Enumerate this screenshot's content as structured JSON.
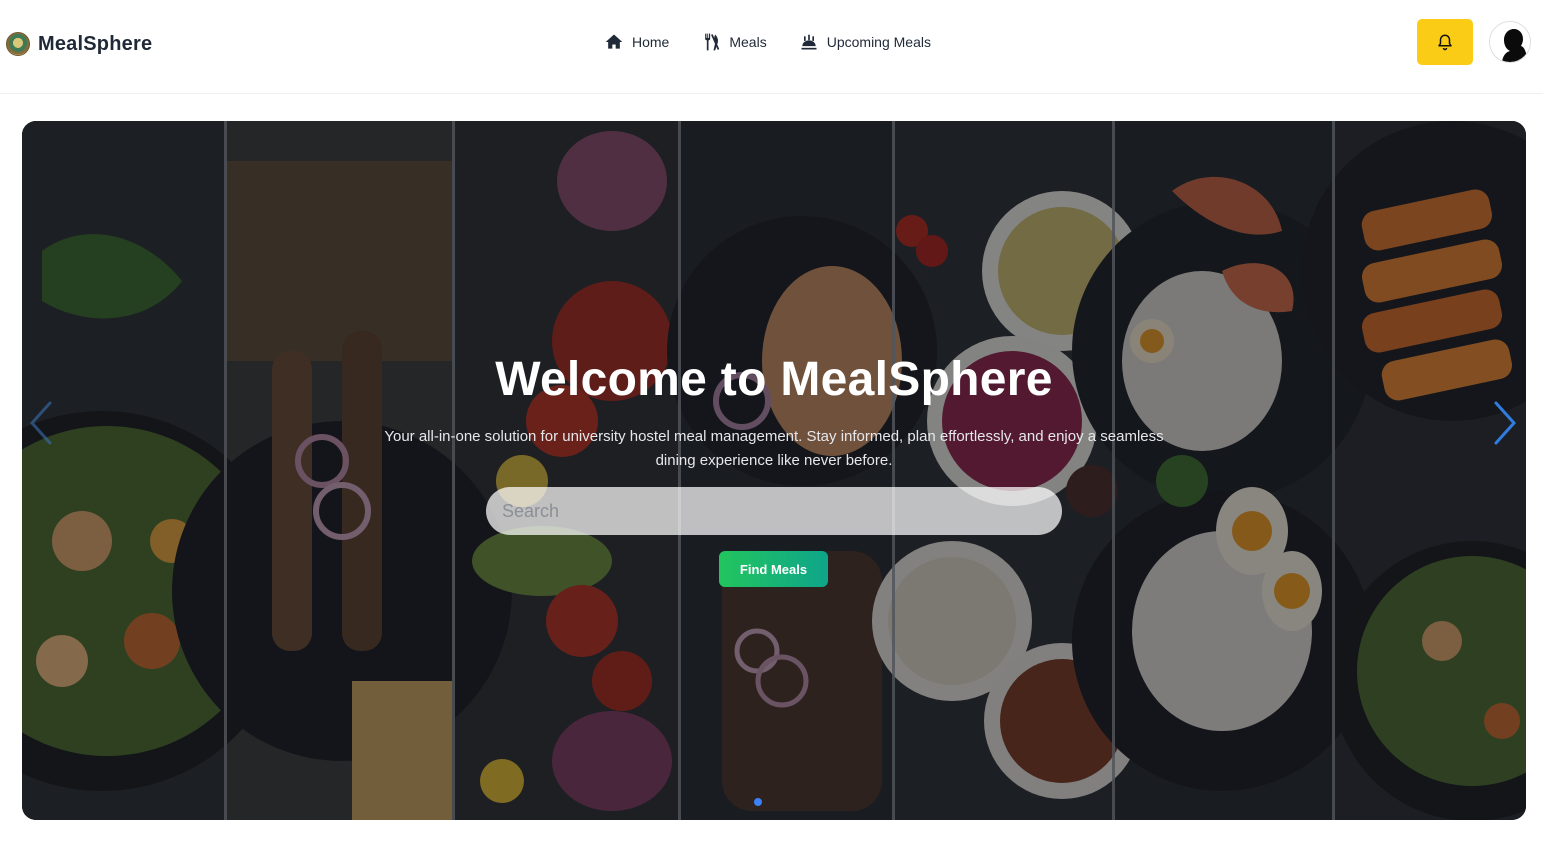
{
  "brand": {
    "name": "MealSphere",
    "logo_icon": "university-crest-icon"
  },
  "nav": {
    "items": [
      {
        "label": "Home",
        "icon": "home-icon"
      },
      {
        "label": "Meals",
        "icon": "utensils-icon"
      },
      {
        "label": "Upcoming Meals",
        "icon": "serving-dish-icon"
      }
    ]
  },
  "header": {
    "notification_icon": "bell-icon",
    "accent_color": "#facc15"
  },
  "hero": {
    "title": "Welcome to MealSphere",
    "subtitle": "Your all-in-one solution for university hostel meal management. Stay informed, plan effortlessly, and enjoy a seamless dining experience like never before.",
    "search_placeholder": "Search",
    "search_value": "",
    "button_label": "Find Meals",
    "button_colors": [
      "#22c55e",
      "#0ea58a"
    ],
    "slide_indicator_color": "#3b82f6"
  }
}
